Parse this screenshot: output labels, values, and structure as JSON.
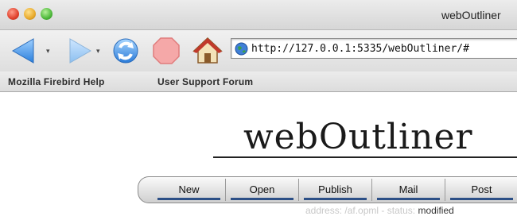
{
  "window": {
    "title": "webOutliner"
  },
  "toolbar": {
    "url": "http://127.0.0.1:5335/webOutliner/#",
    "icons": [
      "back-arrow-icon",
      "forward-arrow-icon",
      "reload-icon",
      "stop-icon",
      "home-icon",
      "globe-icon"
    ]
  },
  "bookmarks": [
    {
      "label": "Mozilla Firebird Help"
    },
    {
      "label": "User Support Forum"
    }
  ],
  "page": {
    "logo_text": "webOutliner",
    "menu": [
      {
        "label": "New"
      },
      {
        "label": "Open"
      },
      {
        "label": "Publish"
      },
      {
        "label": "Mail"
      },
      {
        "label": "Post"
      }
    ],
    "status": {
      "address_label": "address:",
      "address_value": "/af.opml",
      "separator": "-",
      "status_label": "status:",
      "status_value": "modified"
    }
  },
  "colors": {
    "menu_underline": "#2c4f86",
    "status_text": "#c8c8c8"
  }
}
